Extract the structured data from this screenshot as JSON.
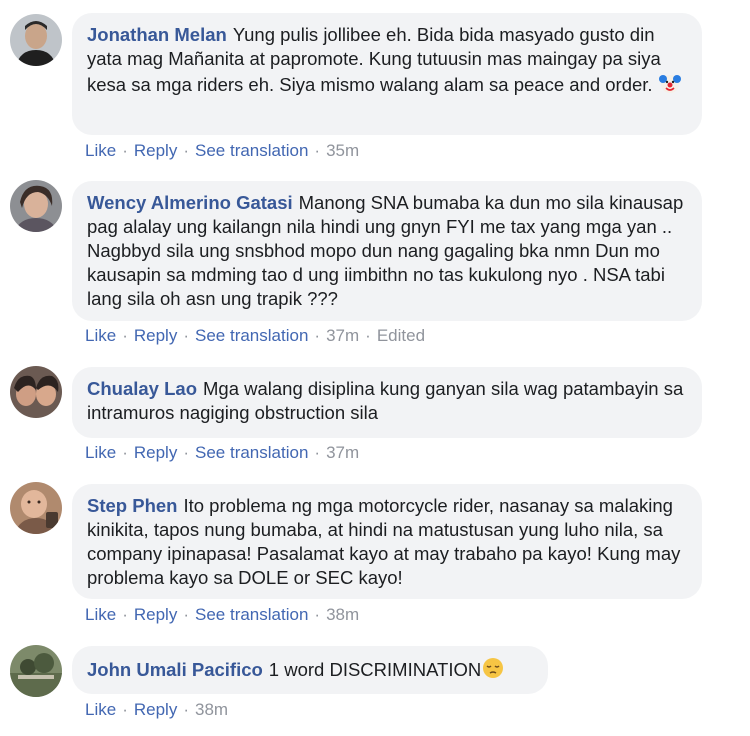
{
  "comments": [
    {
      "author": "Jonathan Melan",
      "text": "Yung pulis jollibee eh. Bida bida masyado gusto din yata mag Mañanita at papromote. Kung tutuusin mas maingay pa siya kesa sa mga riders eh. Siya mismo walang alam sa peace and order.",
      "emoji": "clown-face-icon",
      "actions": {
        "like": "Like",
        "reply": "Reply",
        "translate": "See translation",
        "time": "35m",
        "edited": ""
      }
    },
    {
      "author": "Wency Almerino Gatasi",
      "text": "Manong SNA bumaba ka dun mo sila kinausap pag alalay ung kailangn nila hindi ung gnyn FYI me tax yang mga yan .. Nagbbyd sila ung snsbhod mopo dun nang gagaling bka nmn Dun mo kausapin sa mdming tao d ung iimbithn no tas kukulong nyo . NSA tabi lang sila oh asn ung trapik ???",
      "emoji": "",
      "actions": {
        "like": "Like",
        "reply": "Reply",
        "translate": "See translation",
        "time": "37m",
        "edited": "Edited"
      }
    },
    {
      "author": "Chualay Lao",
      "text": "Mga walang disiplina kung ganyan sila wag patambayin sa intramuros nagiging obstruction sila",
      "emoji": "",
      "actions": {
        "like": "Like",
        "reply": "Reply",
        "translate": "See translation",
        "time": "37m",
        "edited": ""
      }
    },
    {
      "author": "Step Phen",
      "text": "Ito problema ng mga motorcycle rider, nasanay sa malaking kinikita, tapos nung bumaba, at hindi na matustusan yung luho nila, sa company ipinapasa! Pasalamat kayo at may trabaho pa kayo! Kung may problema kayo sa DOLE or SEC kayo!",
      "emoji": "",
      "actions": {
        "like": "Like",
        "reply": "Reply",
        "translate": "See translation",
        "time": "38m",
        "edited": ""
      }
    },
    {
      "author": "John Umali Pacifico",
      "text": "1 word DISCRIMINATION",
      "emoji": "pensive-face-icon",
      "actions": {
        "like": "Like",
        "reply": "Reply",
        "translate": "",
        "time": "38m",
        "edited": ""
      }
    }
  ],
  "colors": {
    "author": "#385898",
    "link": "#4267b2",
    "bubble": "#f2f3f5",
    "meta": "#90949c"
  }
}
